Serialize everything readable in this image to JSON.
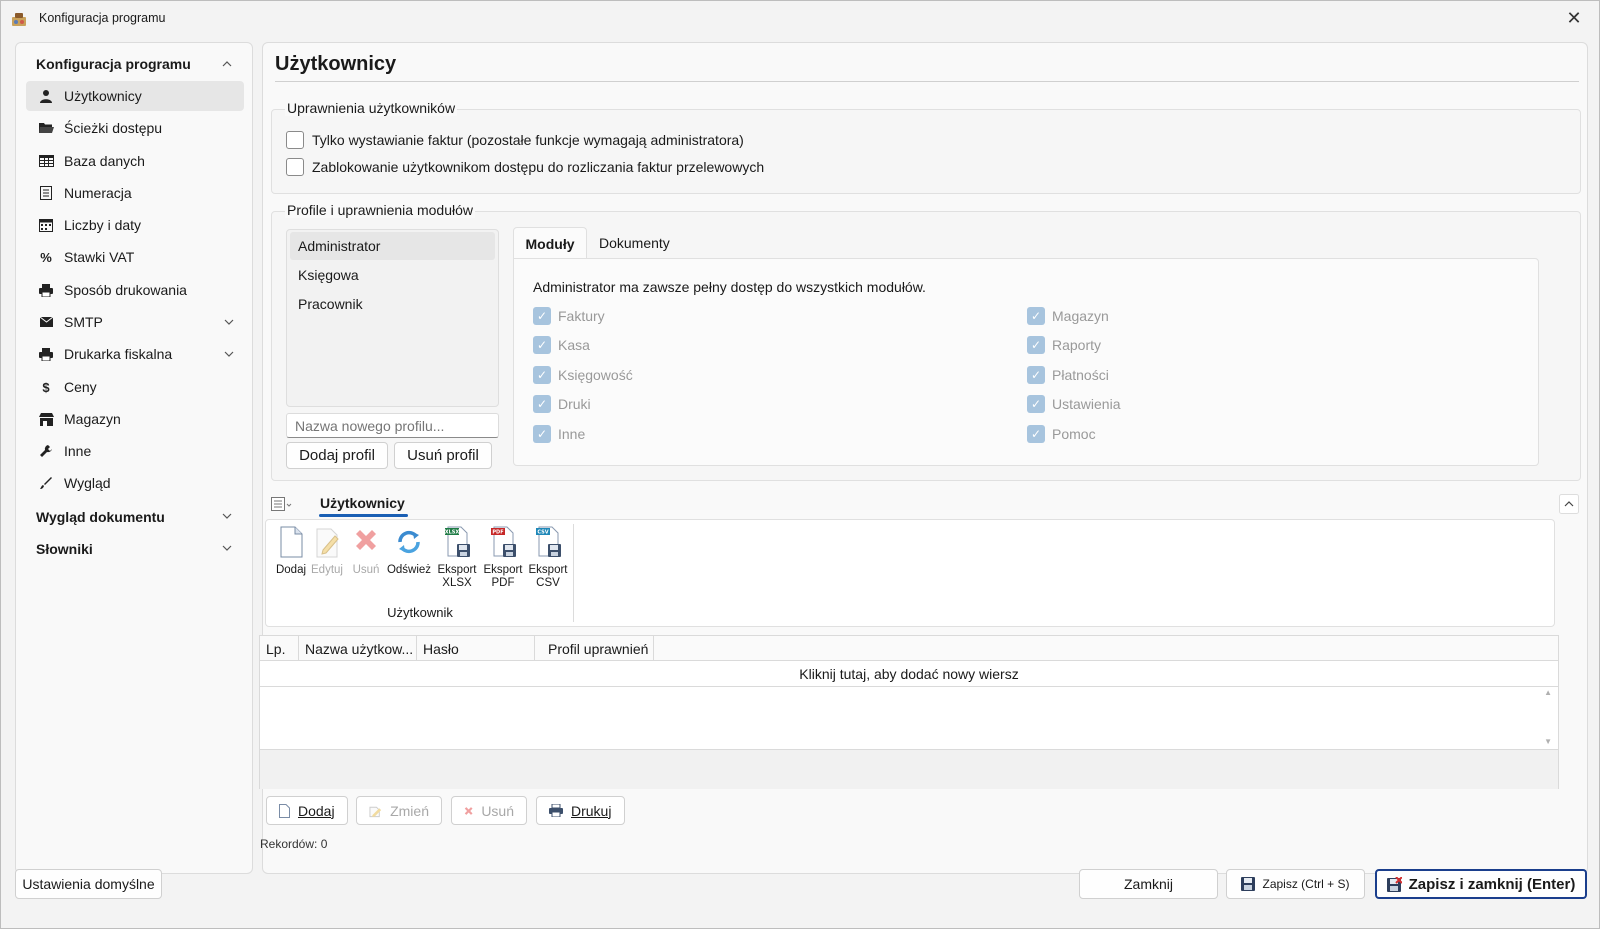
{
  "window": {
    "title": "Konfiguracja programu",
    "close_glyph": "✕"
  },
  "sidebar": {
    "group_config": "Konfiguracja programu",
    "items": [
      {
        "label": "Użytkownicy",
        "icon": "user-icon",
        "active": true
      },
      {
        "label": "Ścieżki dostępu",
        "icon": "folder-icon"
      },
      {
        "label": "Baza danych",
        "icon": "table-icon"
      },
      {
        "label": "Numeracja",
        "icon": "document-list-icon"
      },
      {
        "label": "Liczby i daty",
        "icon": "calendar-icon"
      },
      {
        "label": "Stawki VAT",
        "icon": "percent-icon"
      },
      {
        "label": "Sposób drukowania",
        "icon": "printer-icon"
      },
      {
        "label": "SMTP",
        "icon": "envelope-icon",
        "expandable": true
      },
      {
        "label": "Drukarka fiskalna",
        "icon": "printer-icon",
        "expandable": true
      },
      {
        "label": "Ceny",
        "icon": "dollar-icon"
      },
      {
        "label": "Magazyn",
        "icon": "store-icon"
      },
      {
        "label": "Inne",
        "icon": "wrench-icon"
      },
      {
        "label": "Wygląd",
        "icon": "brush-icon"
      }
    ],
    "group_doc_look": "Wygląd dokumentu",
    "group_dicts": "Słowniki"
  },
  "main": {
    "title": "Użytkownicy",
    "permissions": {
      "title": "Uprawnienia użytkowników",
      "opt1": "Tylko wystawianie faktur (pozostałe funkcje wymagają administratora)",
      "opt2": "Zablokowanie użytkownikom dostępu do rozliczania faktur przelewowych"
    },
    "profiles": {
      "title": "Profile i uprawnienia modułów",
      "list": [
        "Administrator",
        "Księgowa",
        "Pracownik"
      ],
      "new_placeholder": "Nazwa nowego profilu...",
      "add_button": "Dodaj profil",
      "remove_button": "Usuń profil",
      "tabs": [
        "Moduły",
        "Dokumenty"
      ],
      "info": "Administrator ma zawsze pełny dostęp do wszystkich modułów.",
      "modules_left": [
        "Faktury",
        "Kasa",
        "Księgowość",
        "Druki",
        "Inne"
      ],
      "modules_right": [
        "Magazyn",
        "Raporty",
        "Płatności",
        "Ustawienia",
        "Pomoc"
      ],
      "check_glyph": "✓"
    },
    "ribbon": {
      "tab": "Użytkownicy",
      "group_label": "Użytkownik",
      "buttons": [
        {
          "label": "Dodaj",
          "icon": "new-document-icon"
        },
        {
          "label": "Edytuj",
          "icon": "edit-icon",
          "disabled": true
        },
        {
          "label": "Usuń",
          "icon": "delete-icon",
          "disabled": true
        },
        {
          "label": "Odśwież",
          "icon": "refresh-icon"
        },
        {
          "label": "Eksport XLSX",
          "icon": "export-xlsx-icon",
          "badge": "XLSX"
        },
        {
          "label": "Eksport PDF",
          "icon": "export-pdf-icon",
          "badge": "PDF"
        },
        {
          "label": "Eksport CSV",
          "icon": "export-csv-icon",
          "badge": "CSV"
        }
      ]
    },
    "grid": {
      "columns": [
        "Lp.",
        "Nazwa użytkow...",
        "Hasło",
        "Profil uprawnień"
      ],
      "new_row_hint": "Kliknij tutaj, aby dodać nowy wiersz"
    },
    "bottom_buttons": {
      "add": "Dodaj",
      "change": "Zmień",
      "remove": "Usuń",
      "print": "Drukuj"
    },
    "records": "Rekordów: 0"
  },
  "footer": {
    "defaults": "Ustawienia domyślne",
    "close": "Zamknij",
    "save": "Zapisz (Ctrl + S)",
    "save_close": "Zapisz i zamknij (Enter)"
  }
}
